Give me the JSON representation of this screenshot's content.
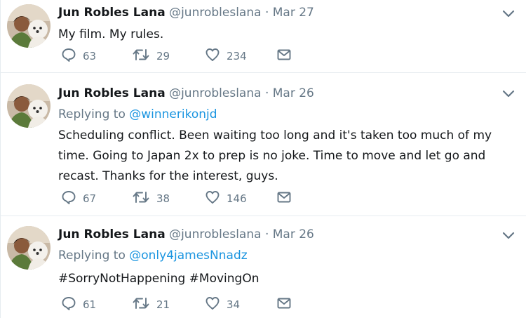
{
  "tweets": [
    {
      "fullname": "Jun Robles Lana",
      "username": "@junrobleslana",
      "separator": "·",
      "time": "Mar 27",
      "replying_prefix": "",
      "replying_to": "",
      "text": "My film. My rules.",
      "hashtags": "",
      "replies": "63",
      "retweets": "29",
      "likes": "234"
    },
    {
      "fullname": "Jun Robles Lana",
      "username": "@junrobleslana",
      "separator": "·",
      "time": "Mar 26",
      "replying_prefix": "Replying to ",
      "replying_to": "@winnerikonjd",
      "text": "Scheduling conflict. Been waiting too long and it's taken too much of my time. Going to Japan 2x to prep is no joke. Time to move and let go and recast. Thanks for the interest, guys.",
      "replies": "67",
      "retweets": "38",
      "likes": "146"
    },
    {
      "fullname": "Jun Robles Lana",
      "username": "@junrobleslana",
      "separator": "·",
      "time": "Mar 26",
      "replying_prefix": "Replying to ",
      "replying_to": "@only4jamesNnadz",
      "hashtags": "#SorryNotHappening #MovingOn",
      "replies": "61",
      "retweets": "21",
      "likes": "34"
    }
  ],
  "icons": {
    "reply": "reply-icon",
    "retweet": "retweet-icon",
    "like": "heart-icon",
    "dm": "envelope-icon",
    "caret": "chevron-down-icon"
  },
  "colors": {
    "text": "#14171a",
    "secondary": "#657786",
    "link": "#1b95e0",
    "divider": "#e6ecf0"
  }
}
